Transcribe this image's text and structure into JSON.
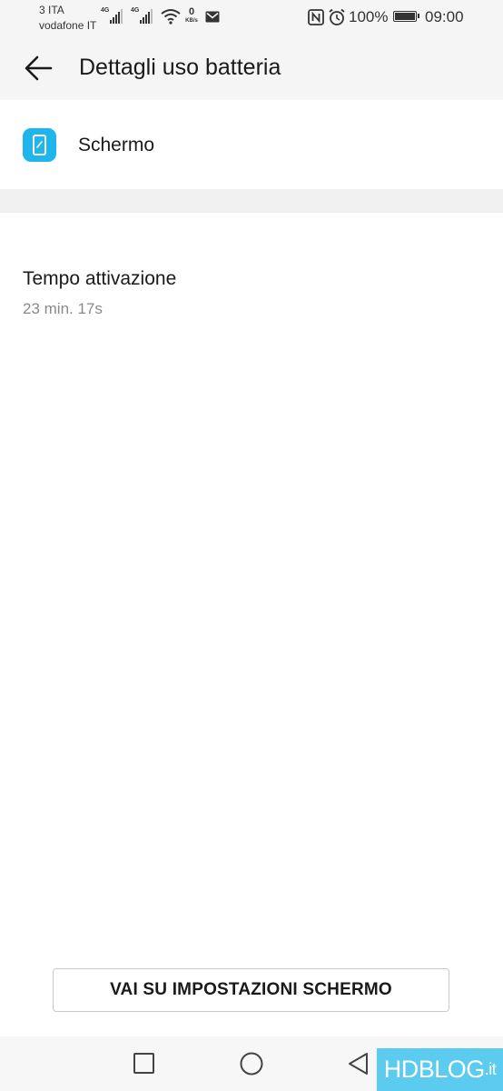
{
  "status_bar": {
    "carrier_1": "3 ITA",
    "carrier_2": "vodafone IT",
    "network_1": "4G",
    "network_2": "4G",
    "data_speed_value": "0",
    "data_speed_unit": "KB/s",
    "battery_percent": "100%",
    "battery_level": 1.0,
    "time": "09:00",
    "icons": [
      "signal-icon",
      "signal-icon",
      "wifi-icon",
      "mail-icon",
      "nfc-icon",
      "alarm-icon",
      "battery-icon"
    ]
  },
  "header": {
    "back_icon": "arrow-left-icon",
    "title": "Dettagli uso batteria"
  },
  "app": {
    "icon": "screen-icon",
    "icon_color": "#1fb6ec",
    "name": "Schermo"
  },
  "stats": {
    "label": "Tempo attivazione",
    "value": "23 min. 17s"
  },
  "actions": {
    "settings_button": "VAI SU IMPOSTAZIONI SCHERMO"
  },
  "navigation": {
    "recent": "square-icon",
    "home": "circle-icon",
    "back": "triangle-back-icon"
  },
  "watermark": {
    "hd": "HD",
    "blog": "BLOG",
    "tld": ".it",
    "color": "#5bcbf0"
  }
}
